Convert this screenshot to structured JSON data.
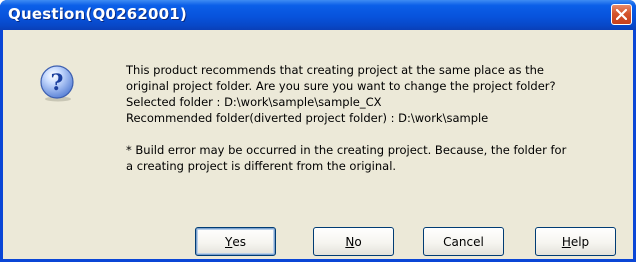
{
  "window": {
    "title": "Question(Q0262001)"
  },
  "message": {
    "lines": [
      "This product recommends that creating project at the same place as the",
      "original project folder. Are you sure you want to change the project folder?",
      "Selected folder : D:\\work\\sample\\sample_CX",
      "Recommended folder(diverted project folder) : D:\\work\\sample"
    ],
    "note_lines": [
      "* Build error may be occurred in the creating project. Because, the folder for",
      "a creating project is different from the original."
    ]
  },
  "buttons": {
    "yes": {
      "label": "Yes",
      "mnemonic": "Y",
      "rest": "es"
    },
    "no": {
      "label": "No",
      "mnemonic": "N",
      "rest": "o"
    },
    "cancel": {
      "label": "Cancel"
    },
    "help": {
      "label": "Help",
      "mnemonic": "H",
      "rest": "elp"
    }
  },
  "icons": {
    "dialog_icon": "question-icon",
    "close": "close-icon"
  },
  "colors": {
    "titlebar": "#0853dc",
    "client_bg": "#ece9d8",
    "close_button": "#d4542c",
    "button_border": "#003c74"
  }
}
